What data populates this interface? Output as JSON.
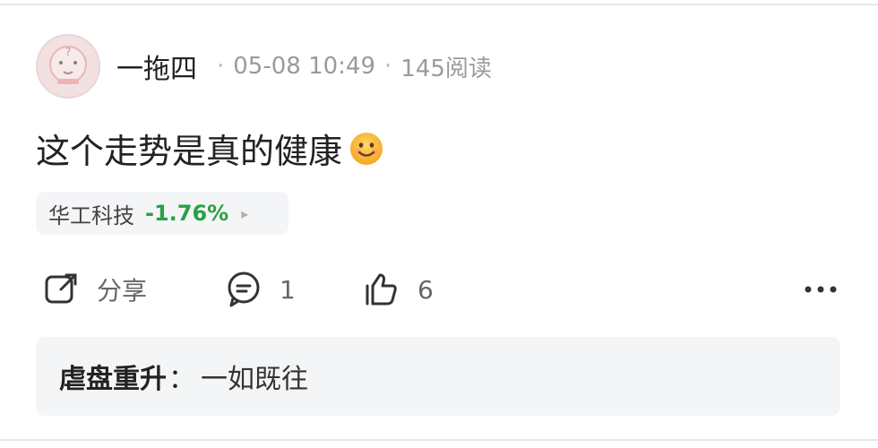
{
  "post": {
    "author": "一拖四",
    "date": "05-08 10:49",
    "reads": "145阅读",
    "separator": "·",
    "text": "这个走势是真的健康",
    "emoji": "smiling-face-icon"
  },
  "stock": {
    "name": "华工科技",
    "change": "-1.76%",
    "change_color": "#2aa146",
    "arrow": "▸"
  },
  "actions": {
    "share_label": "分享",
    "comment_count": "1",
    "like_count": "6",
    "icons": {
      "share": "share-icon",
      "comment": "comment-icon",
      "like": "thumbs-up-icon",
      "more": "more-horizontal-icon"
    }
  },
  "comment_preview": {
    "user": "虐盘重升",
    "separator": "：",
    "text": "一如既往"
  }
}
